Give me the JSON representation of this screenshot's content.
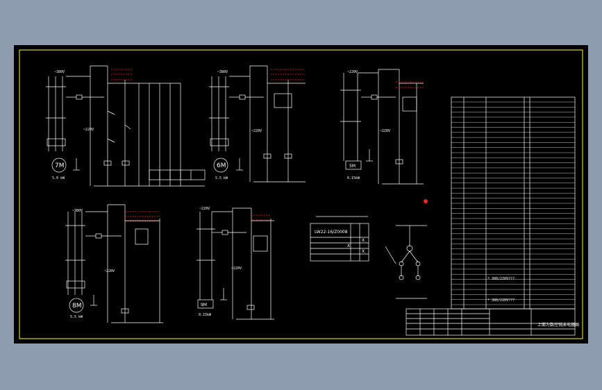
{
  "motors": [
    {
      "id": "7M",
      "voltage": "~380V",
      "power": "5.0 kW"
    },
    {
      "id": "6M",
      "voltage": "~380V",
      "power": "5.5 kW"
    },
    {
      "id": "5M",
      "voltage": "~220V",
      "power": "0.15kW"
    },
    {
      "id": "8M",
      "voltage": "~380V",
      "power": "5.5 kW"
    },
    {
      "id": "9M",
      "voltage": "~220V",
      "power": "0.15kW"
    }
  ],
  "control_voltage": "~220V",
  "switch_table": {
    "title": "LW22-16/Z0008",
    "marks": [
      "X",
      "X",
      "X"
    ]
  },
  "legend_lines": [
    "* 380/220V???",
    "* 380/220V???"
  ],
  "title_block": {
    "drawing_title": "上面为数控铣床电器图"
  },
  "colors": {
    "background": "#000000",
    "frame": "#ffff00",
    "wire": "#ffffff",
    "accent": "#ff2020",
    "page": "#8e9cb0"
  }
}
